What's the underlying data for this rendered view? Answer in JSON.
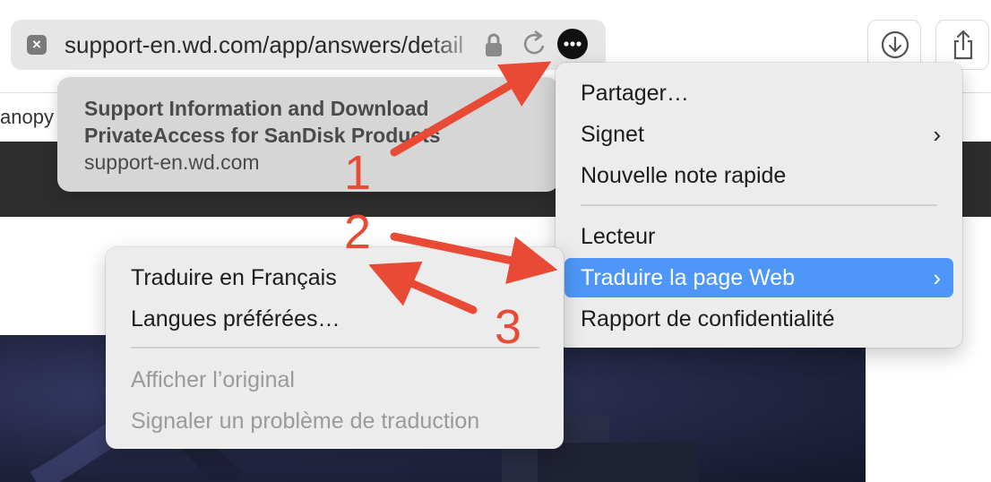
{
  "browser": {
    "url": "support-en.wd.com/app/answers/detail",
    "bookmark_fragment": "anopy -"
  },
  "tooltip": {
    "title_line1": "Support Information and Download",
    "title_line2": "PrivateAccess for SanDisk Products",
    "domain": "support-en.wd.com"
  },
  "menu": {
    "items": [
      {
        "label": "Partager…"
      },
      {
        "label": "Signet",
        "chevron": "›"
      },
      {
        "label": "Nouvelle note rapide"
      },
      {
        "label": "Lecteur"
      },
      {
        "label": "Traduire la page Web",
        "chevron": "›"
      },
      {
        "label": "Rapport de confidentialité"
      }
    ]
  },
  "submenu": {
    "items": [
      {
        "label": "Traduire en Français"
      },
      {
        "label": "Langues préférées…"
      },
      {
        "label": "Afficher l’original"
      },
      {
        "label": "Signaler un problème de traduction"
      }
    ]
  },
  "annotations": {
    "labels": [
      "1",
      "2",
      "3"
    ],
    "color": "#e94a35"
  },
  "colors": {
    "selection": "#4e97f8",
    "menu_bg": "#ececec",
    "dark_band": "#2d2d2d"
  }
}
